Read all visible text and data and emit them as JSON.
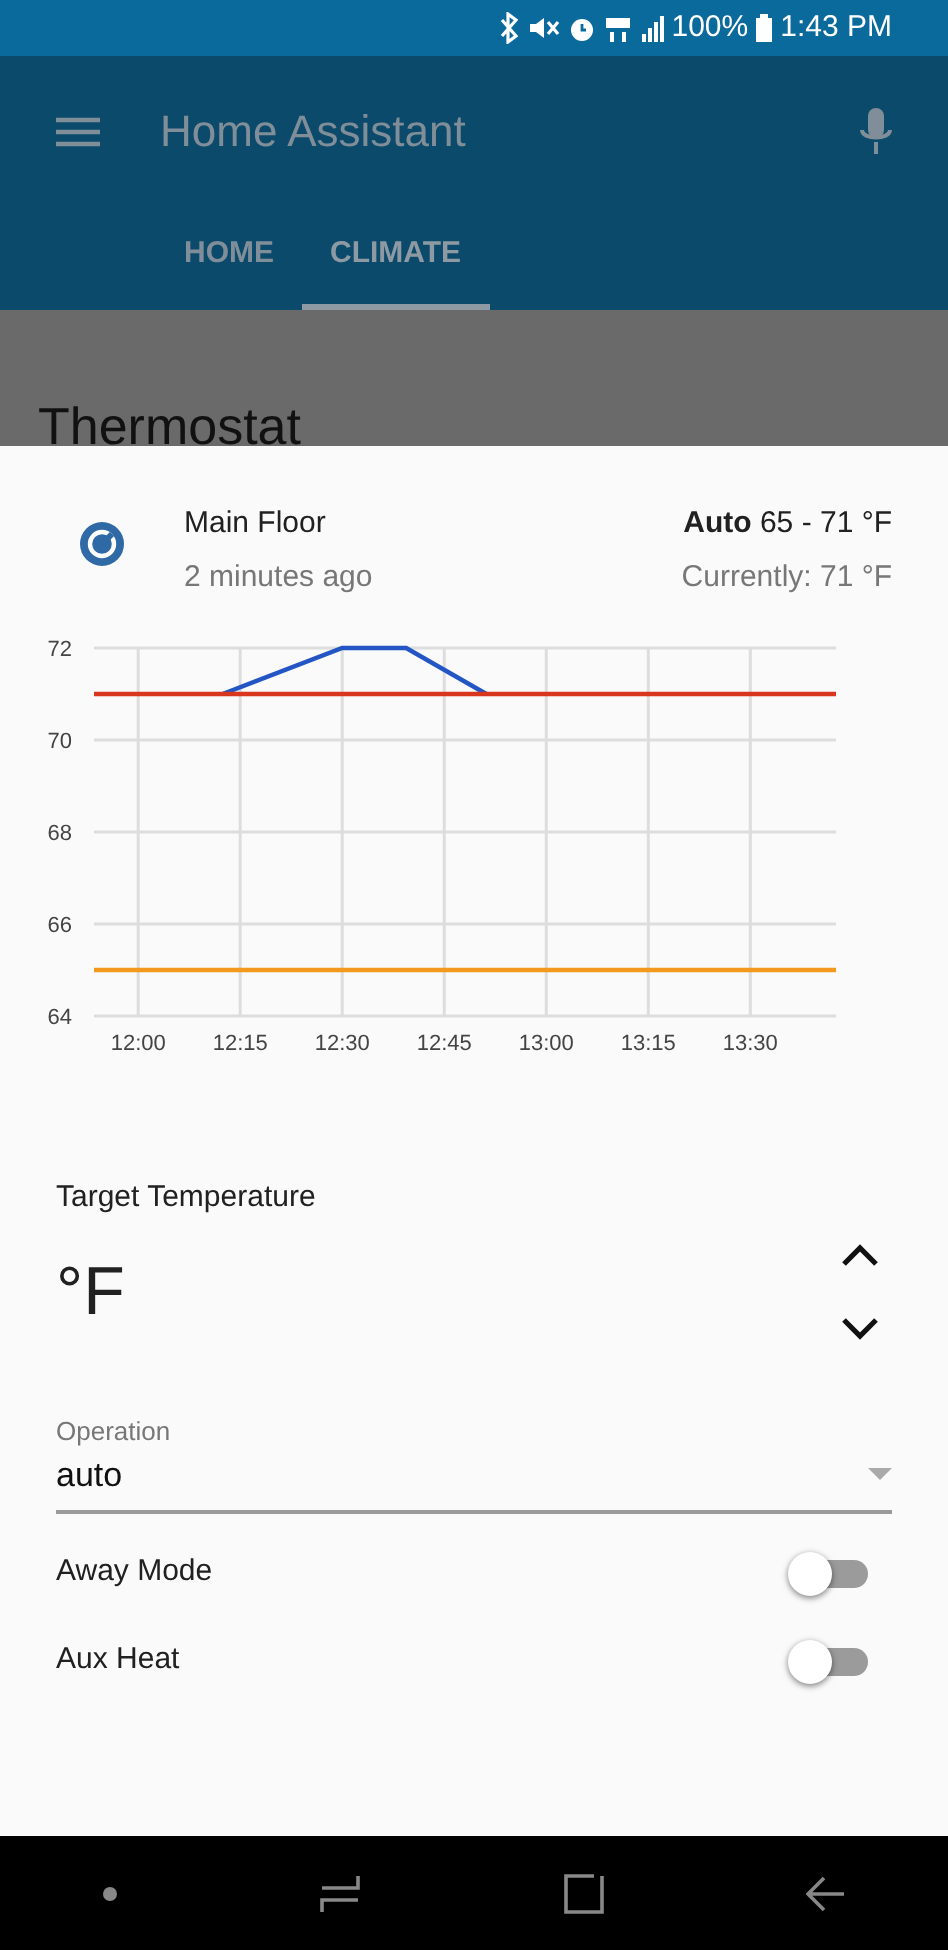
{
  "status_bar": {
    "battery": "100%",
    "time": "1:43 PM"
  },
  "app_bar": {
    "title": "Home Assistant"
  },
  "tabs": [
    {
      "label": "HOME",
      "selected": false
    },
    {
      "label": "CLIMATE",
      "selected": true
    }
  ],
  "background": {
    "heading": "Thermostat"
  },
  "dialog": {
    "name": "Main Floor",
    "updated": "2 minutes ago",
    "mode": "Auto",
    "range": "65 - 71 °F",
    "current": "Currently: 71 °F",
    "chart_data": {
      "type": "line",
      "x": [
        11.8917,
        12.2067,
        12.5,
        12.6567,
        12.8533,
        13.71
      ],
      "xlim": [
        11.8917,
        13.71
      ],
      "ylim": [
        64,
        72
      ],
      "grid": true,
      "xticks": [
        {
          "value": 12,
          "label": "12:00"
        },
        {
          "value": 12.25,
          "label": "12:15"
        },
        {
          "value": 12.5,
          "label": "12:30"
        },
        {
          "value": 12.75,
          "label": "12:45"
        },
        {
          "value": 13,
          "label": "13:00"
        },
        {
          "value": 13.25,
          "label": "13:15"
        },
        {
          "value": 13.5,
          "label": "13:30"
        }
      ],
      "yticks": [
        64,
        66,
        68,
        70,
        72
      ],
      "series": [
        {
          "color": "#2355c4",
          "values": [
            null,
            71,
            72,
            72,
            71,
            null
          ]
        },
        {
          "color": "#d9361e",
          "values": [
            71,
            71,
            71,
            71,
            71,
            71
          ]
        },
        {
          "color": "#f39a1e",
          "values": [
            65,
            65,
            65,
            65,
            65,
            65
          ]
        }
      ]
    },
    "target_label": "Target Temperature",
    "target_unit": "°F",
    "operation": {
      "label": "Operation",
      "value": "auto"
    },
    "toggles": [
      {
        "label": "Away Mode",
        "on": false
      },
      {
        "label": "Aux Heat",
        "on": false
      }
    ]
  }
}
